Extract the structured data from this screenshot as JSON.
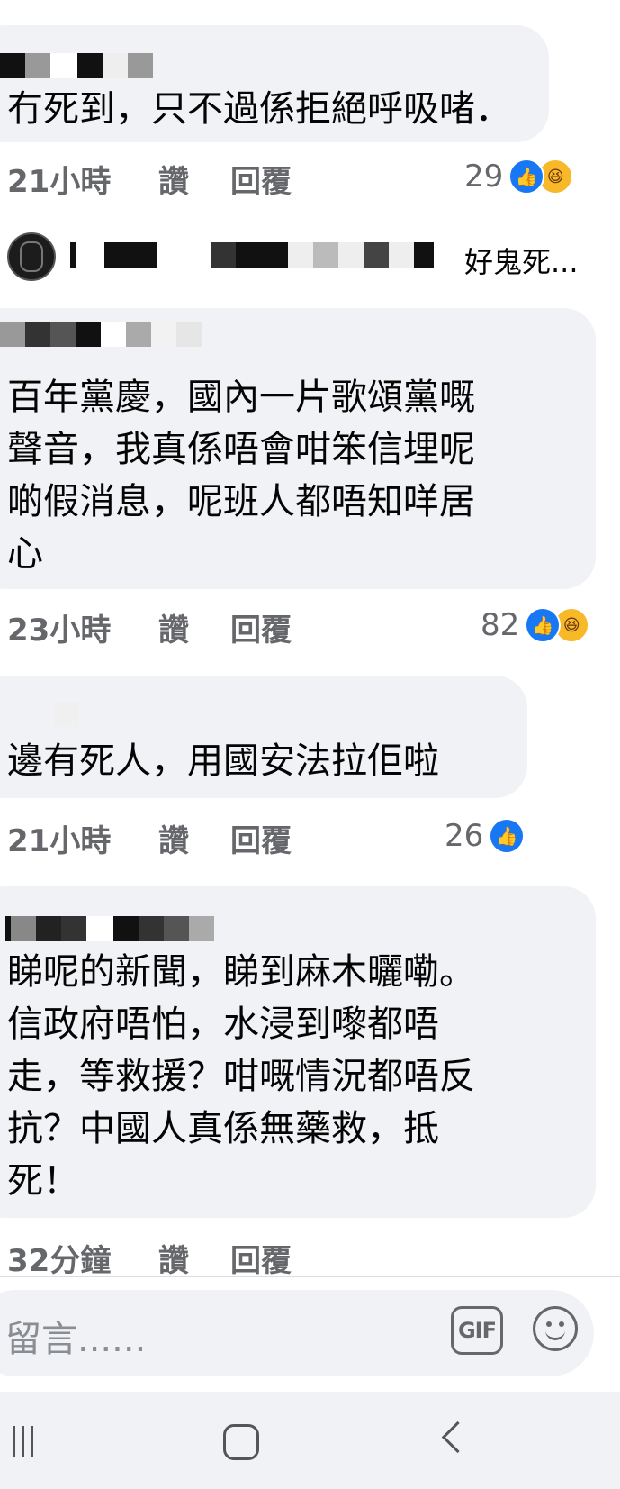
{
  "comments": [
    {
      "text": "冇死到，只不過係拒絕呼吸啫．",
      "time": "21小時",
      "like_label": "讚",
      "reply_label": "回覆",
      "reaction_count": "29"
    },
    {
      "text": "百年黨慶，國內一片歌頌黨嘅\n聲音，我真係唔會咁笨信埋呢\n啲假消息，呢班人都唔知咩居\n心",
      "time": "23小時",
      "like_label": "讚",
      "reply_label": "回覆",
      "reaction_count": "82"
    },
    {
      "text": "邊有死人，用國安法拉佢啦",
      "time": "21小時",
      "like_label": "讚",
      "reply_label": "回覆",
      "reaction_count": "26"
    },
    {
      "text": "睇呢的新聞，睇到麻木曬嘞。\n信政府唔怕，水浸到嚟都唔\n走，等救援？咁嘅情況都唔反\n抗？中國人真係無藥救，抵\n死！",
      "time": "32分鐘",
      "like_label": "讚",
      "reply_label": "回覆"
    }
  ],
  "reply_preview": {
    "snippet": "好鬼死..."
  },
  "composer": {
    "placeholder": "留言......",
    "gif_label": "GIF"
  },
  "icons": {
    "like": "thumbs-up-icon",
    "haha": "haha-icon",
    "emoji": "smiley-icon",
    "recents": "recents-icon",
    "home": "home-icon",
    "back": "back-icon"
  },
  "colors": {
    "bubble": "#f0f2f5",
    "meta_text": "#65676b",
    "like_blue": "#1877f2",
    "haha_yellow": "#f7b928"
  }
}
